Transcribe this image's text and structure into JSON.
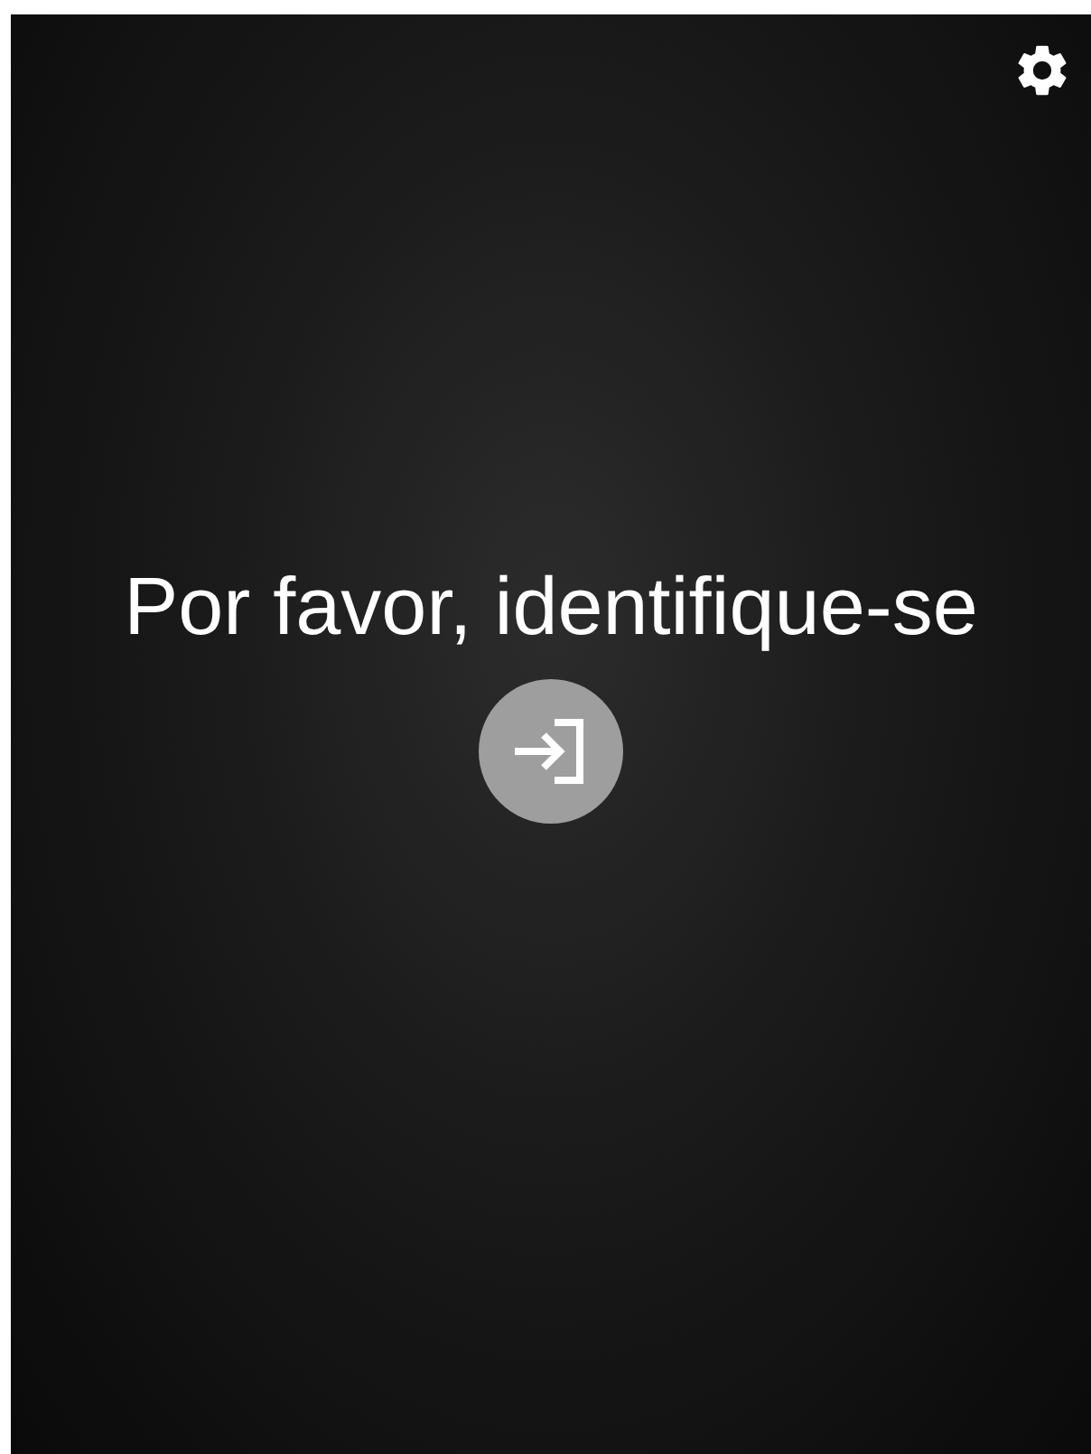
{
  "title": "Por favor, identifique-se"
}
